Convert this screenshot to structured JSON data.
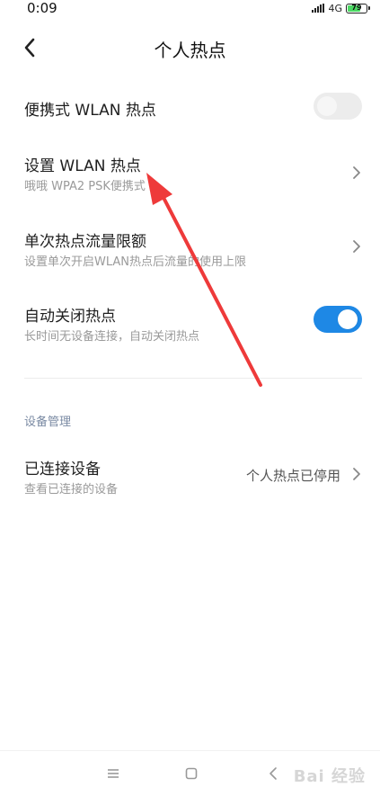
{
  "status_bar": {
    "time": "0:09",
    "network": "4G",
    "battery": "79",
    "battery_level": 0.79
  },
  "header": {
    "title": "个人热点"
  },
  "rows": {
    "portable_hotspot": {
      "title": "便携式 WLAN 热点",
      "toggle_on": false
    },
    "setup_hotspot": {
      "title": "设置 WLAN 热点",
      "subtitle": "哦哦 WPA2 PSK便携式"
    },
    "data_limit": {
      "title": "单次热点流量限额",
      "subtitle": "设置单次开启WLAN热点后流量的使用上限"
    },
    "auto_close": {
      "title": "自动关闭热点",
      "subtitle": "长时间无设备连接，自动关闭热点",
      "toggle_on": true
    }
  },
  "section": {
    "title": "设备管理"
  },
  "connected": {
    "title": "已连接设备",
    "subtitle": "查看已连接的设备",
    "value": "个人热点已停用"
  },
  "watermark": {
    "text": "Bai 经验"
  },
  "colors": {
    "accent": "#1e88e5",
    "arrow": "#ee3a3a",
    "section_text": "#7a8aa3"
  }
}
